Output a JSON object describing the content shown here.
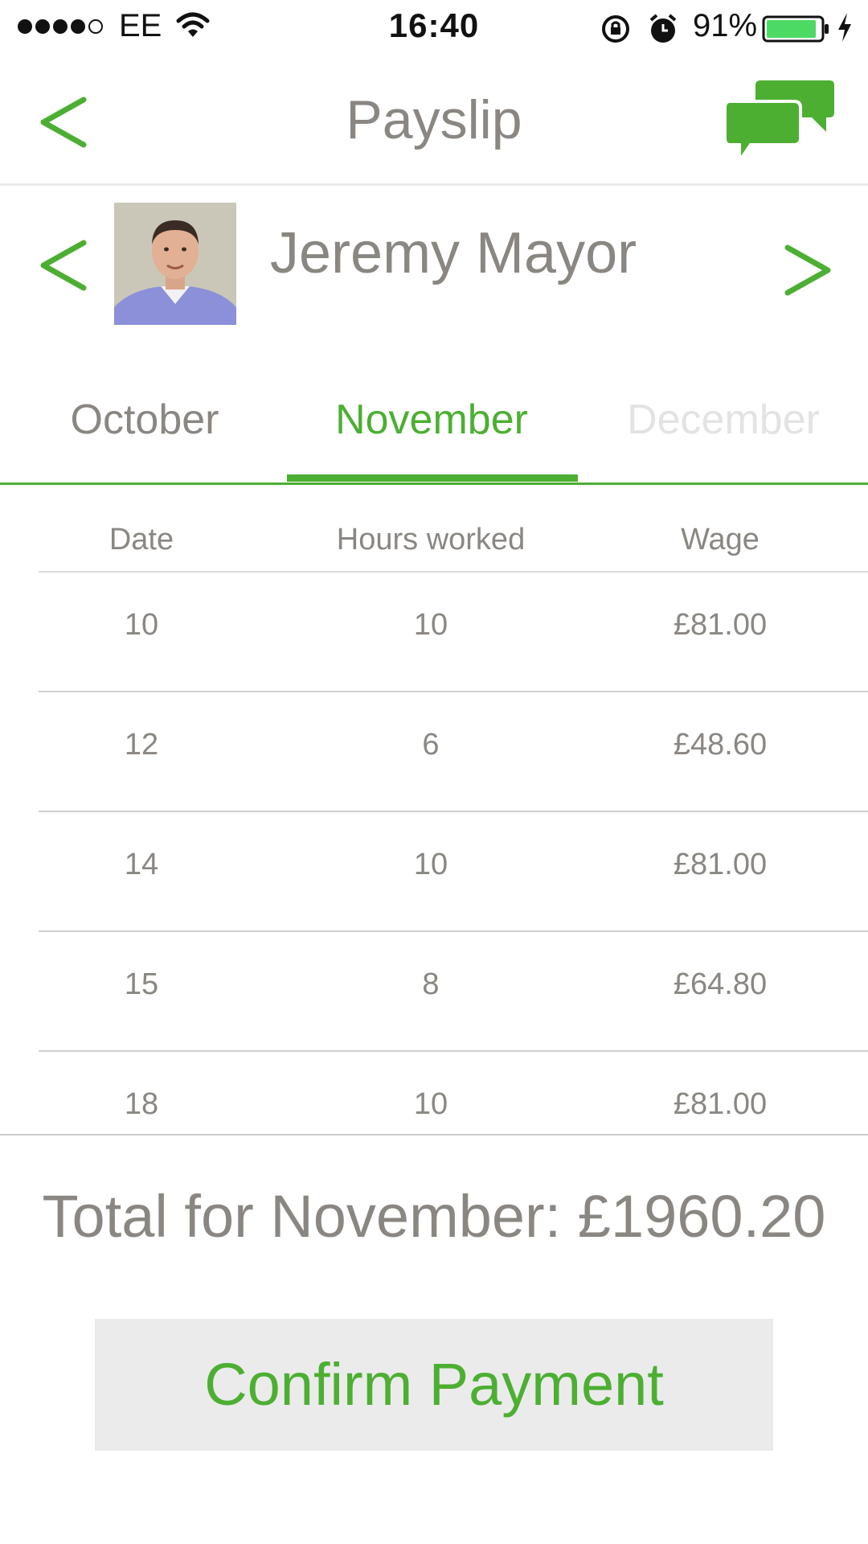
{
  "status_bar": {
    "carrier": "EE",
    "time": "16:40",
    "battery_percent": "91%",
    "battery_level": 0.91,
    "signal_bars": 4,
    "signal_total": 5
  },
  "header": {
    "title": "Payslip",
    "back_icon": "chevron-left-icon",
    "chat_icon": "chat-bubbles-icon"
  },
  "employee": {
    "name": "Jeremy Mayor",
    "avatar_icon": "employee-photo"
  },
  "months": {
    "prev": "October",
    "current": "November",
    "next": "December"
  },
  "table": {
    "headers": [
      "Date",
      "Hours worked",
      "Wage"
    ],
    "rows": [
      {
        "date": "10",
        "hours": "10",
        "wage": "£81.00"
      },
      {
        "date": "12",
        "hours": "6",
        "wage": "£48.60"
      },
      {
        "date": "14",
        "hours": "10",
        "wage": "£81.00"
      },
      {
        "date": "15",
        "hours": "8",
        "wage": "£64.80"
      },
      {
        "date": "18",
        "hours": "10",
        "wage": "£81.00"
      }
    ]
  },
  "total": {
    "text": "Total for November: £1960.20"
  },
  "confirm_button": {
    "label": "Confirm Payment"
  },
  "colors": {
    "accent": "#4caf32",
    "text": "#8a8783",
    "button_bg": "#ebebeb"
  }
}
